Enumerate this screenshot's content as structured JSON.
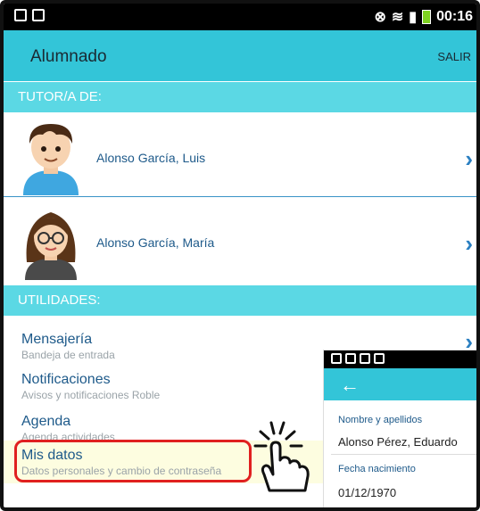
{
  "statusbar": {
    "time": "00:16"
  },
  "appbar": {
    "title": "Alumnado",
    "salir": "SALIR"
  },
  "sections": {
    "tutor": "TUTOR/A DE:",
    "utilidades": "UTILIDADES:"
  },
  "tutors": [
    {
      "name": "Alonso García, Luis"
    },
    {
      "name": "Alonso García, María"
    }
  ],
  "utilities": [
    {
      "title": "Mensajería",
      "subtitle": "Bandeja de entrada"
    },
    {
      "title": "Notificaciones",
      "subtitle": "Avisos y notificaciones Roble"
    },
    {
      "title": "Agenda",
      "subtitle": "Agenda actividades"
    },
    {
      "title": "Mis datos",
      "subtitle": "Datos personales y cambio de contraseña"
    }
  ],
  "overlay": {
    "back_icon": "arrow-left-icon",
    "fields": [
      {
        "label": "Nombre y apellidos",
        "value": "Alonso Pérez, Eduardo"
      },
      {
        "label": "Fecha nacimiento",
        "value": "01/12/1970"
      }
    ]
  },
  "colors": {
    "appbar": "#33c5d8",
    "section": "#5bd8e4",
    "link": "#1e5a8a",
    "highlight": "#e02020"
  },
  "icons": [
    "chevron-right-icon",
    "tap-hand-icon",
    "battery-icon",
    "signal-icon"
  ]
}
